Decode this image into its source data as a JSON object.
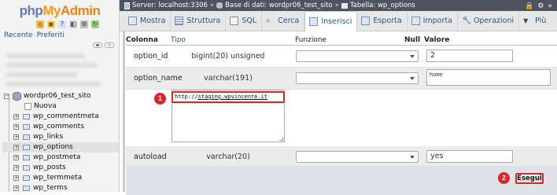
{
  "app": {
    "logo_php": "php",
    "logo_my": "My",
    "logo_admin": "Admin",
    "nav_recent": "Recente",
    "nav_favorites": "Preferiti"
  },
  "breadcrumb": {
    "server": "Server: localhost:3306",
    "database": "Base di dati: wordpr06_test_sito",
    "table": "Tabella: wp_options",
    "separator": "»"
  },
  "tabs": [
    {
      "label": "Mostra",
      "icon": "table-icon"
    },
    {
      "label": "Struttura",
      "icon": "structure-icon"
    },
    {
      "label": "SQL",
      "icon": "sql-icon"
    },
    {
      "label": "Cerca",
      "icon": "search-icon"
    },
    {
      "label": "Inserisci",
      "icon": "insert-icon",
      "active": true
    },
    {
      "label": "Esporta",
      "icon": "export-icon"
    },
    {
      "label": "Importa",
      "icon": "import-icon"
    },
    {
      "label": "Operazioni",
      "icon": "wrench-icon"
    },
    {
      "label": "Più",
      "icon": "chevron-down-icon"
    }
  ],
  "tree": {
    "database": "wordpr06_test_sito",
    "new_label": "Nuova",
    "tables": [
      "wp_commentmeta",
      "wp_comments",
      "wp_links",
      "wp_options",
      "wp_postmeta",
      "wp_posts",
      "wp_termmeta",
      "wp_terms"
    ],
    "active_table": "wp_options"
  },
  "form": {
    "headers": {
      "column": "Colonna",
      "type": "Tipo",
      "function": "Funzione",
      "null": "Null",
      "value": "Valore"
    },
    "fields": [
      {
        "name": "option_id",
        "type": "bigint(20) unsigned",
        "value": "2"
      },
      {
        "name": "option_name",
        "type": "varchar(191)",
        "value": "home"
      },
      {
        "name": "",
        "type": "",
        "value": "http://staging.wpvincente.it",
        "url_prefix": "http://",
        "url_link": "staging.wpvincente.it"
      },
      {
        "name": "autoload",
        "type": "varchar(20)",
        "value": "yes"
      }
    ],
    "submit_label": "Esegui"
  },
  "annotations": {
    "badge1": "1",
    "badge2": "2"
  },
  "colors": {
    "accent_red": "#d9252b",
    "link_blue": "#235a81",
    "topbar": "#4d5460"
  }
}
